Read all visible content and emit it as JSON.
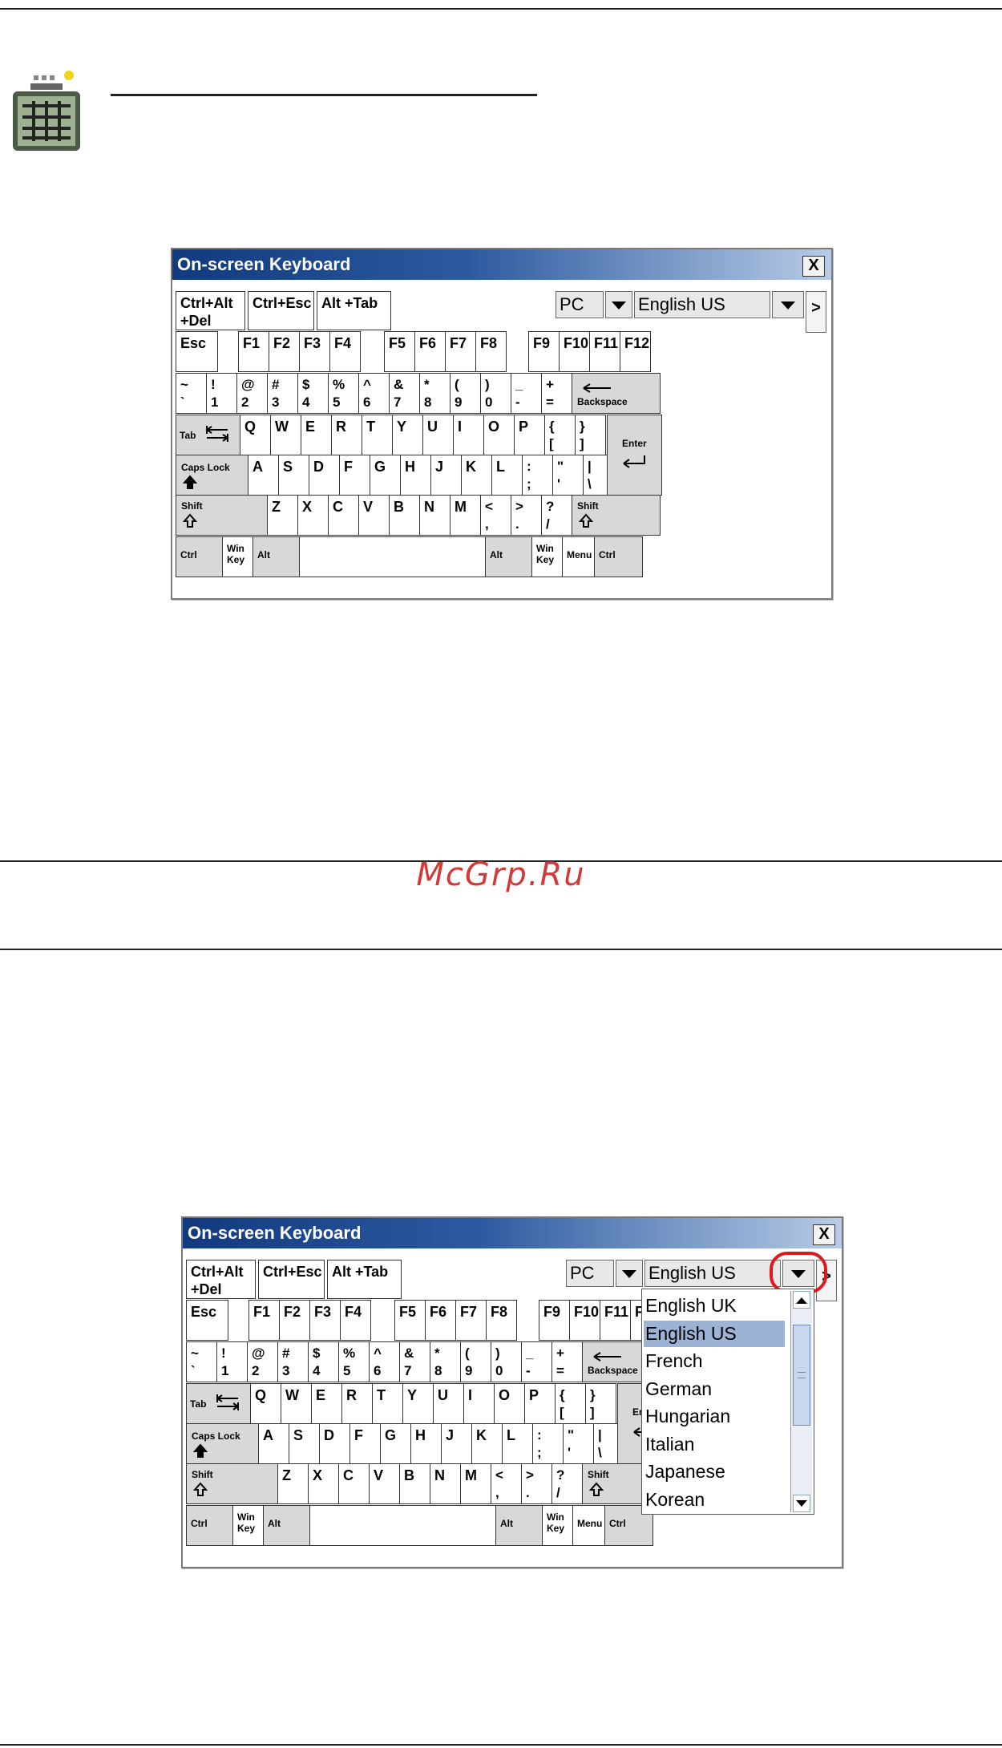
{
  "watermark": "McGrp.Ru",
  "osk_top": {
    "title": "On-screen Keyboard",
    "close_label": "X",
    "mode_value": "PC",
    "language_value": "English US",
    "more_label": ">"
  },
  "osk_bottom": {
    "title": "On-screen Keyboard",
    "close_label": "X",
    "mode_value": "PC",
    "language_value": "English US",
    "more_label": ">",
    "language_options": [
      "English UK",
      "English US",
      "French",
      "German",
      "Hungarian",
      "Italian",
      "Japanese",
      "Korean"
    ],
    "selected_option": "English US"
  },
  "keys": {
    "ctrl_alt_del": "Ctrl+Alt\n+Del",
    "ctrl_esc": "Ctrl+Esc",
    "alt_tab": "Alt +Tab",
    "esc": "Esc",
    "f1": "F1",
    "f2": "F2",
    "f3": "F3",
    "f4": "F4",
    "f5": "F5",
    "f6": "F6",
    "f7": "F7",
    "f8": "F8",
    "f9": "F9",
    "f10": "F10",
    "f11": "F11",
    "f12": "F12",
    "num_row": [
      [
        "~",
        "`"
      ],
      [
        "!",
        "1"
      ],
      [
        "@",
        "2"
      ],
      [
        "#",
        "3"
      ],
      [
        "$",
        "4"
      ],
      [
        "%",
        "5"
      ],
      [
        "^",
        "6"
      ],
      [
        "&",
        "7"
      ],
      [
        "*",
        "8"
      ],
      [
        "(",
        "9"
      ],
      [
        ")",
        "0"
      ],
      [
        "_",
        "-"
      ],
      [
        "+",
        "="
      ]
    ],
    "backspace": "Backspace",
    "tab": "Tab",
    "q_row": [
      "Q",
      "W",
      "E",
      "R",
      "T",
      "Y",
      "U",
      "I",
      "O",
      "P"
    ],
    "brackets": [
      [
        "{",
        "["
      ],
      [
        "}",
        "]"
      ]
    ],
    "enter": "Enter",
    "caps_lock": "Caps Lock",
    "a_row": [
      "A",
      "S",
      "D",
      "F",
      "G",
      "H",
      "J",
      "K",
      "L"
    ],
    "a_row_syms": [
      [
        ":",
        ";"
      ],
      [
        "\"",
        "'"
      ],
      [
        "|",
        "\\"
      ]
    ],
    "shift": "Shift",
    "z_row": [
      "Z",
      "X",
      "C",
      "V",
      "B",
      "N",
      "M"
    ],
    "z_row_syms": [
      [
        "<",
        ","
      ],
      [
        ">",
        "."
      ],
      [
        "?",
        "/"
      ]
    ],
    "ctrl": "Ctrl",
    "win_key": "Win\nKey",
    "alt": "Alt",
    "menu": "Menu"
  }
}
